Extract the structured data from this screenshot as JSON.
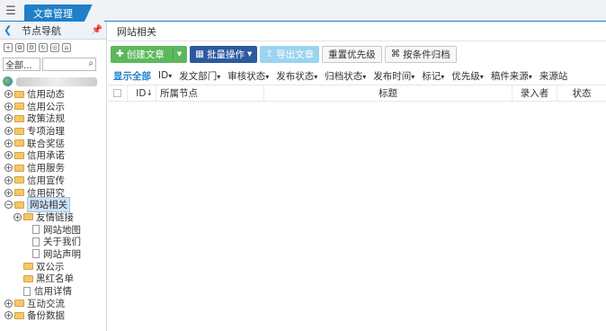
{
  "tabbar": {
    "active_tab": "文章管理",
    "close_glyph": "×"
  },
  "sidebar": {
    "title": "节点导航",
    "search_select": "全部...",
    "tree": [
      {
        "label": "信用动态",
        "type": "folder",
        "exp": "+"
      },
      {
        "label": "信用公示",
        "type": "folder",
        "exp": "+"
      },
      {
        "label": "政策法规",
        "type": "folder",
        "exp": "+"
      },
      {
        "label": "专项治理",
        "type": "folder",
        "exp": "+"
      },
      {
        "label": "联合奖惩",
        "type": "folder",
        "exp": "+"
      },
      {
        "label": "信用承诺",
        "type": "folder",
        "exp": "+"
      },
      {
        "label": "信用服务",
        "type": "folder",
        "exp": "+"
      },
      {
        "label": "信用宣传",
        "type": "folder",
        "exp": "+"
      },
      {
        "label": "信用研究",
        "type": "folder",
        "exp": "+"
      },
      {
        "label": "网站相关",
        "type": "folder",
        "exp": "−",
        "selected": true
      },
      {
        "label": "友情链接",
        "type": "folder",
        "exp": "+",
        "indent": 1
      },
      {
        "label": "网站地图",
        "type": "doc",
        "indent": 2
      },
      {
        "label": "关于我们",
        "type": "doc",
        "indent": 2
      },
      {
        "label": "网站声明",
        "type": "doc",
        "indent": 2
      },
      {
        "label": "双公示",
        "type": "folder",
        "indent": 1
      },
      {
        "label": "黑红名单",
        "type": "folder",
        "indent": 1
      },
      {
        "label": "信用详情",
        "type": "doc",
        "indent": 1
      },
      {
        "label": "互动交流",
        "type": "folder",
        "exp": "+"
      },
      {
        "label": "备份数据",
        "type": "folder",
        "exp": "+"
      }
    ]
  },
  "main": {
    "heading": "网站相关",
    "buttons": {
      "create": "创建文章",
      "batch": "批量操作",
      "export": "导出文章",
      "reset_priority": "重置优先级",
      "archive": "按条件归档"
    },
    "filters": [
      "显示全部",
      "ID",
      "发文部门",
      "审核状态",
      "发布状态",
      "归档状态",
      "发布时间",
      "标记",
      "优先级",
      "稿件来源",
      "来源站"
    ],
    "columns": [
      "ID",
      "所属节点",
      "标题",
      "录入者",
      "状态"
    ],
    "id_sort_glyph": "↓"
  },
  "colors": {
    "accent": "#1f7fc8",
    "green": "#5cb85c",
    "navy": "#2c5a9e"
  }
}
